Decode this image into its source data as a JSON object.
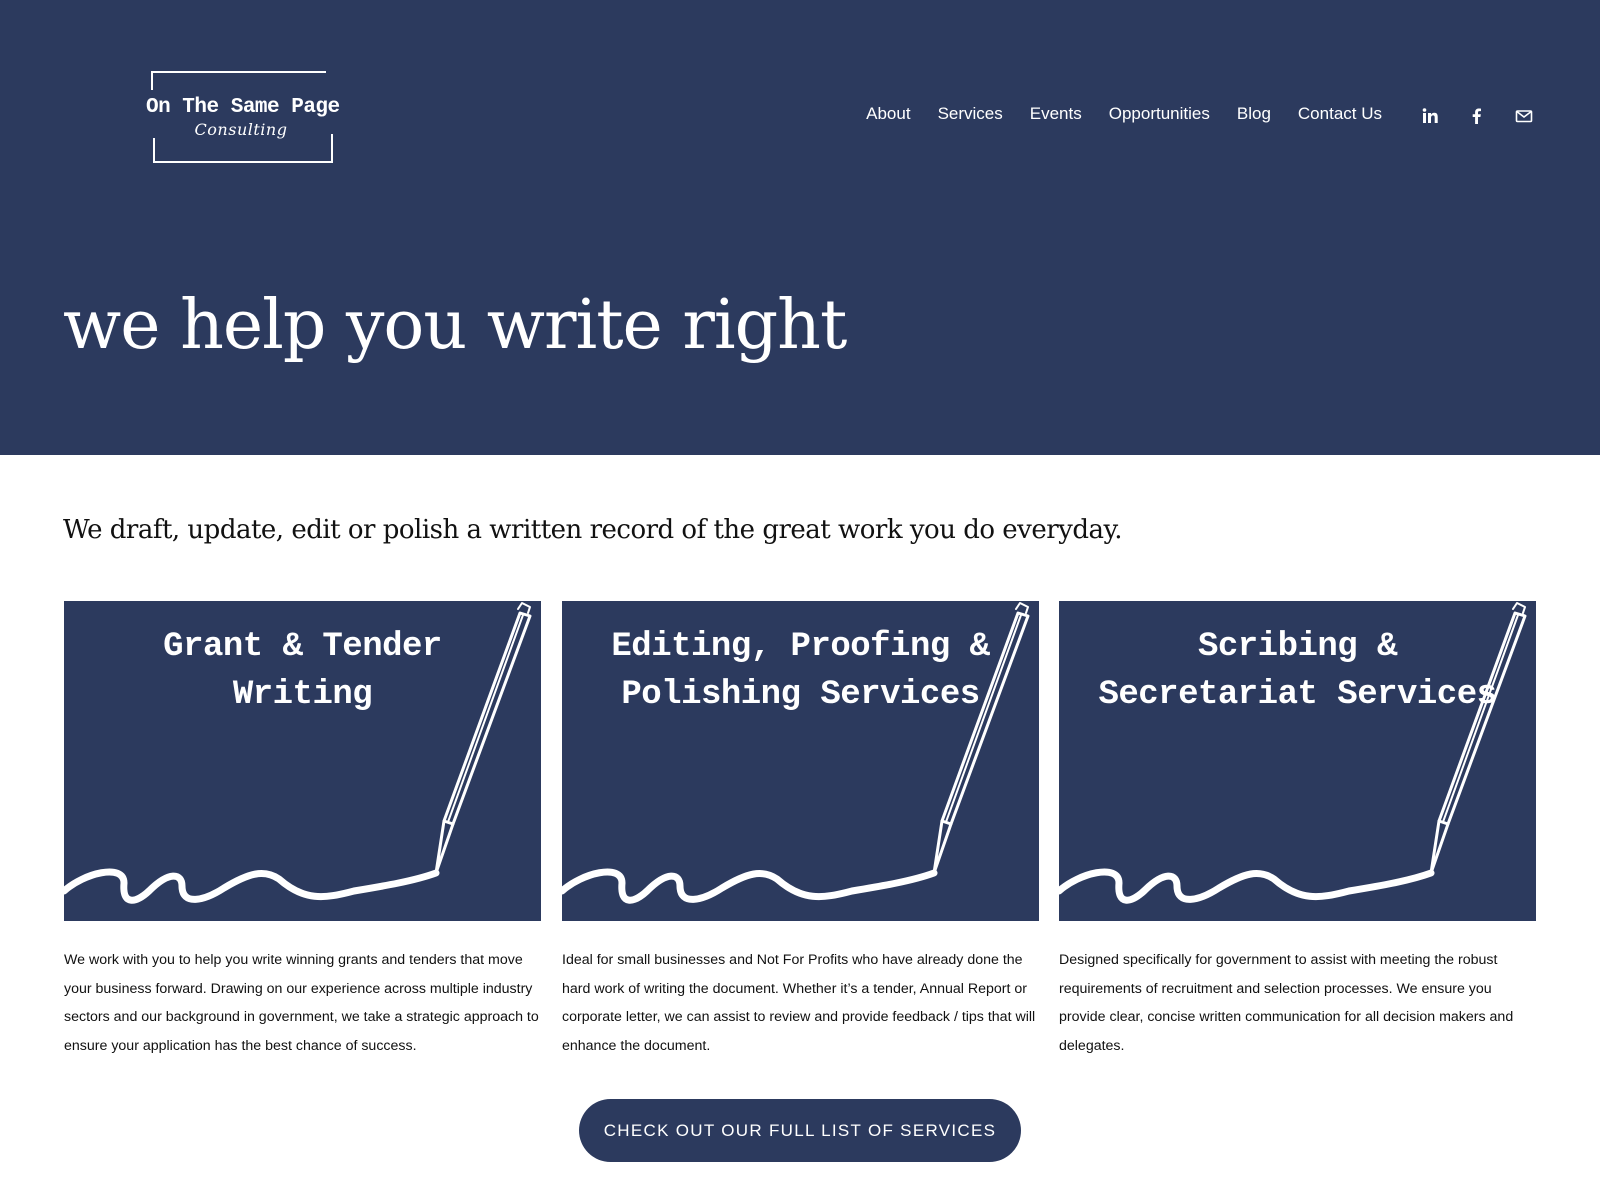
{
  "brand": {
    "logo_line1": "On The Same Page",
    "logo_line2": "Consulting"
  },
  "nav": {
    "items": [
      {
        "label": "About"
      },
      {
        "label": "Services"
      },
      {
        "label": "Events"
      },
      {
        "label": "Opportunities"
      },
      {
        "label": "Blog"
      },
      {
        "label": "Contact Us"
      }
    ]
  },
  "social": {
    "icons": [
      "linkedin-icon",
      "facebook-icon",
      "email-icon"
    ]
  },
  "hero": {
    "title": "we help you write right"
  },
  "intro": {
    "text": "We draft, update, edit or polish a written record of the great work you do everyday."
  },
  "services": [
    {
      "image_title_line1": "Grant & Tender",
      "image_title_line2": "Writing",
      "description": "We work with you to help you write winning grants and tenders that move your business forward. Drawing on our experience across multiple industry sectors and our background in government, we take a strategic approach to ensure your application has the best chance of success."
    },
    {
      "image_title_line1": "Editing, Proofing &",
      "image_title_line2": "Polishing Services",
      "description": "Ideal for small businesses and Not For Profits who have already done the hard work of writing the document. Whether it’s a tender, Annual Report or corporate letter, we can assist to review and provide feedback / tips that will enhance the document."
    },
    {
      "image_title_line1": "Scribing &",
      "image_title_line2": "Secretariat Services",
      "description": "Designed specifically for government to assist with meeting the robust requirements of recruitment and selection processes. We ensure you provide clear, concise written communication for all decision makers and delegates."
    }
  ],
  "cta": {
    "label": "CHECK OUT OUR FULL LIST OF SERVICES"
  },
  "colors": {
    "navy": "#2c3a5e",
    "white": "#ffffff",
    "text": "#111111"
  }
}
